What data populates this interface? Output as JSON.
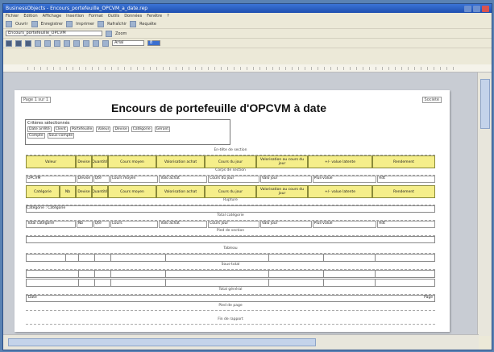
{
  "window": {
    "title": "BusinessObjects - Encours_portefeuille_OPCVM_a_date.rep"
  },
  "menu": [
    "Fichier",
    "Edition",
    "Affichage",
    "Insertion",
    "Format",
    "Outils",
    "Données",
    "Fenêtre",
    "?"
  ],
  "toolbar1": {
    "items": [
      "Ouvrir",
      "Enregistrer",
      "Imprimer",
      "Rafraîchir",
      "Requête"
    ]
  },
  "toolbar2": {
    "report_field": "Encours_portefeuille_OPCVM",
    "zoom_label": "Zoom"
  },
  "toolbar3": {
    "font_field": "Arial",
    "size_field": "8"
  },
  "report": {
    "title": "Encours de portefeuille d'OPCVM à date",
    "ref_left": "Page 1 sur 1",
    "ref_right": "Société",
    "criteria_header": "Critères sélectionnés",
    "criteria_line1": [
      "Date arrêté",
      "Client",
      "Portefeuille",
      "Valeur",
      "Devise",
      "Catégorie",
      "Gérant"
    ],
    "criteria_line2": [
      "Compte",
      "Sous-compte"
    ],
    "band_header": "En-tête de section",
    "columns1": [
      "Valeur",
      "Devise",
      "Quantité",
      "Cours moyen",
      "Valorisation achat",
      "Cours du jour",
      "Valorisation au cours du jour",
      "+/- value latente",
      "Rendement"
    ],
    "body_band1": "Corps de section",
    "row1": [
      "OPCVM",
      "Devise",
      "Qté",
      "Cours moyen",
      "Valo achat",
      "Cours du jour",
      "Valo jour",
      "Plus-value",
      "Rdt"
    ],
    "columns2": [
      "Catégorie",
      "Nb",
      "Devise",
      "Quantité",
      "Cours moyen",
      "Valorisation achat",
      "Cours du jour",
      "Valorisation au cours du jour",
      "+/- value latente",
      "Rendement"
    ],
    "break_band": "Rupture",
    "category_line": "Catégorie : Catégorie",
    "total_band": "Total catégorie",
    "total_row": [
      "Total catégorie",
      "Nb",
      "Qté",
      "Cours",
      "Valo achat",
      "Cours jour",
      "Valo jour",
      "Plus-value",
      "Rdt"
    ],
    "footer_band1": "Pied de section",
    "grid_band": "Tableau",
    "grid_band2": "Sous-total",
    "grid_band3": "Total général",
    "footer_band2": "Pied de page",
    "footer_left": "Date",
    "footer_right": "Page",
    "page_band": "Fin de rapport"
  }
}
